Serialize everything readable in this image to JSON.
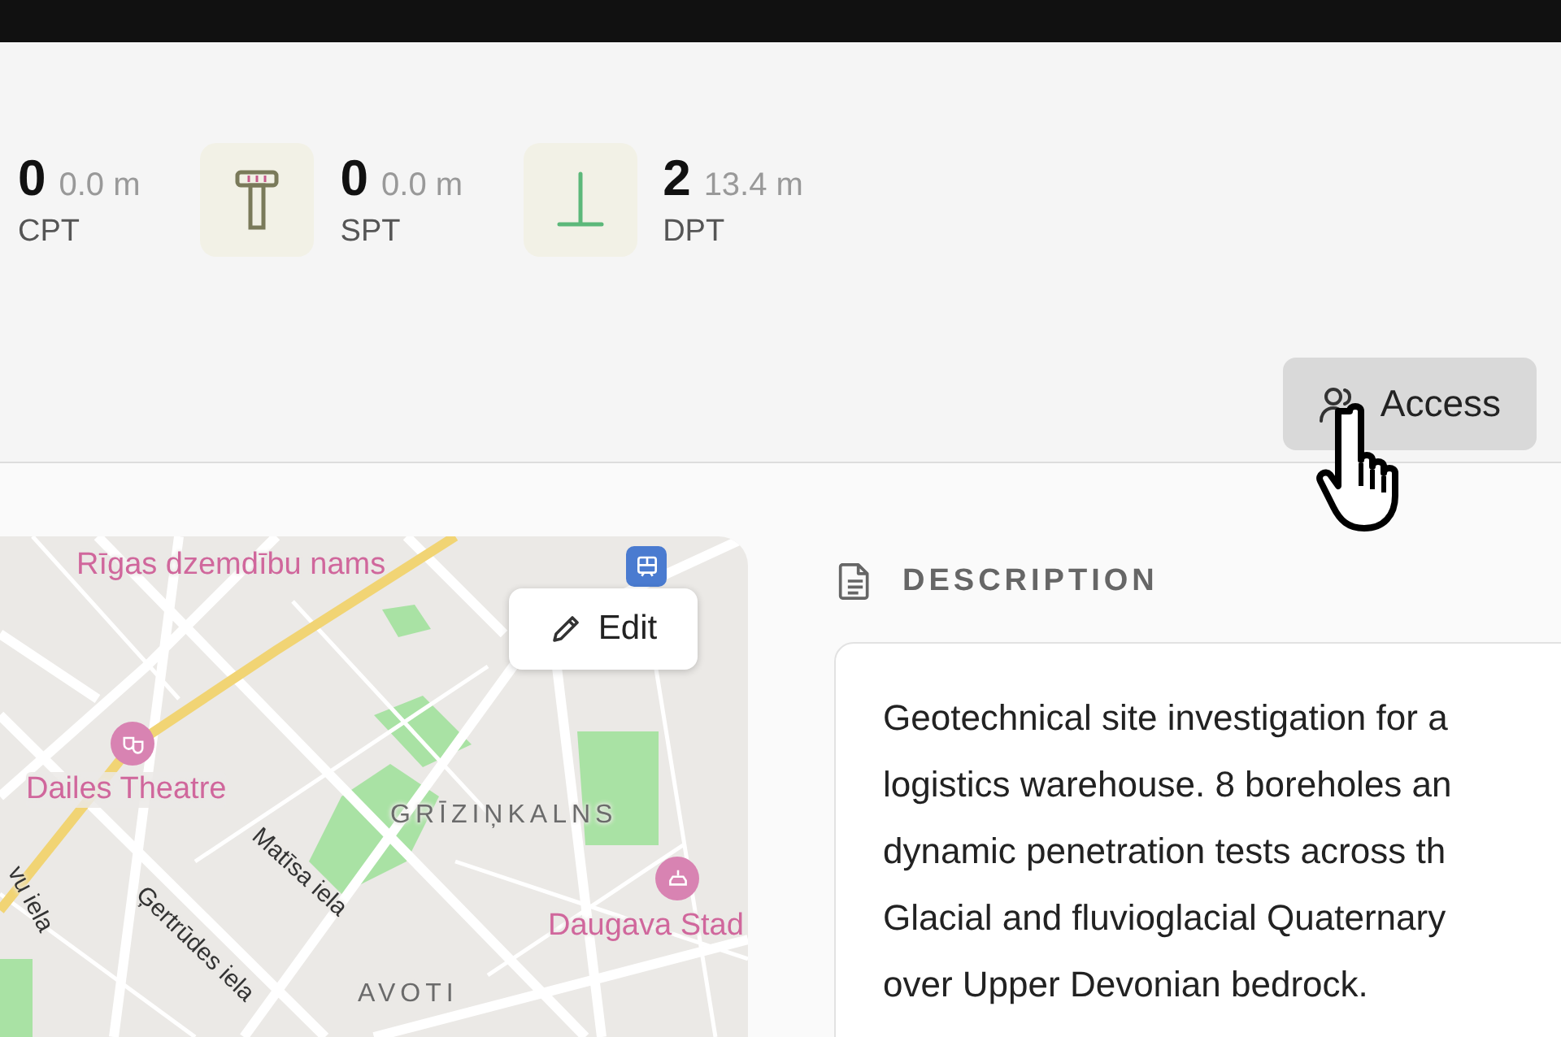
{
  "stats": [
    {
      "kind": "none",
      "count": "0",
      "depth": "0.0 m",
      "label": "CPT"
    },
    {
      "kind": "spt",
      "count": "0",
      "depth": "0.0 m",
      "label": "SPT"
    },
    {
      "kind": "dpt",
      "count": "2",
      "depth": "13.4 m",
      "label": "DPT"
    }
  ],
  "access_button": {
    "label": "Access"
  },
  "map": {
    "edit_button": {
      "label": "Edit"
    },
    "labels": [
      {
        "kind": "poi",
        "text": "Rīgas dzemdību nams"
      },
      {
        "kind": "poi",
        "text": "Dailes Theatre"
      },
      {
        "kind": "district",
        "text": "GRĪZIŅKALNS"
      },
      {
        "kind": "poi",
        "text": "Daugava Stad"
      },
      {
        "kind": "street",
        "text": "Matīsa iela"
      },
      {
        "kind": "street",
        "text": "Ģertrūdes iela"
      },
      {
        "kind": "street",
        "text": "vu iela"
      },
      {
        "kind": "district",
        "text": "AVOTI"
      }
    ]
  },
  "description": {
    "heading": "DESCRIPTION",
    "text": "Geotechnical site investigation for a\nlogistics warehouse. 8 boreholes an\ndynamic penetration tests across th\nGlacial and fluvioglacial Quaternary\nover Upper Devonian bedrock."
  }
}
